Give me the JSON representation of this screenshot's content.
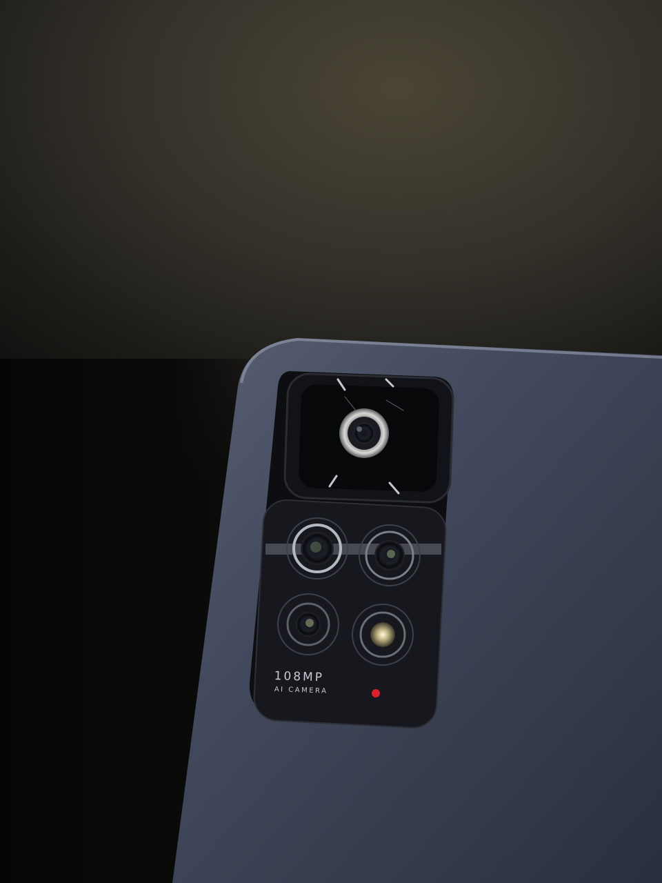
{
  "camera_module": {
    "megapixel_text": "108MP",
    "camera_text": "AI CAMERA"
  },
  "colors": {
    "phone_body": "#3b4152",
    "module_black": "#0d0e11",
    "indicator_red": "#e0202a"
  }
}
